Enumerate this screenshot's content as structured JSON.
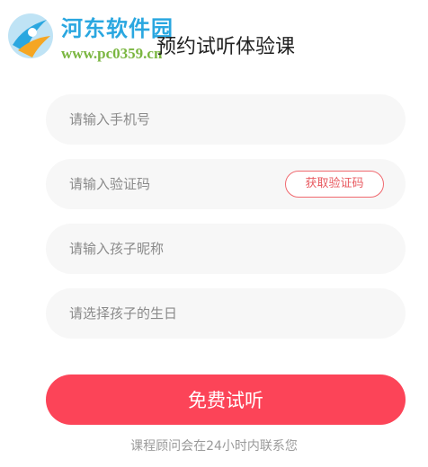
{
  "watermark": {
    "title": "河东软件园",
    "url": "www.pc0359.cn"
  },
  "page_title": "预约试听体验课",
  "form": {
    "phone_placeholder": "请输入手机号",
    "code_placeholder": "请输入验证码",
    "get_code_label": "获取验证码",
    "child_nickname_placeholder": "请输入孩子昵称",
    "child_birthday_placeholder": "请选择孩子的生日"
  },
  "submit_label": "免费试听",
  "footnote": "课程顾问会在24小时内联系您",
  "colors": {
    "accent": "#fc4458",
    "code_button_border": "#f0696f",
    "field_background": "#f7f7f7",
    "watermark_title": "#2aa7e0",
    "watermark_url": "#7ab640"
  }
}
